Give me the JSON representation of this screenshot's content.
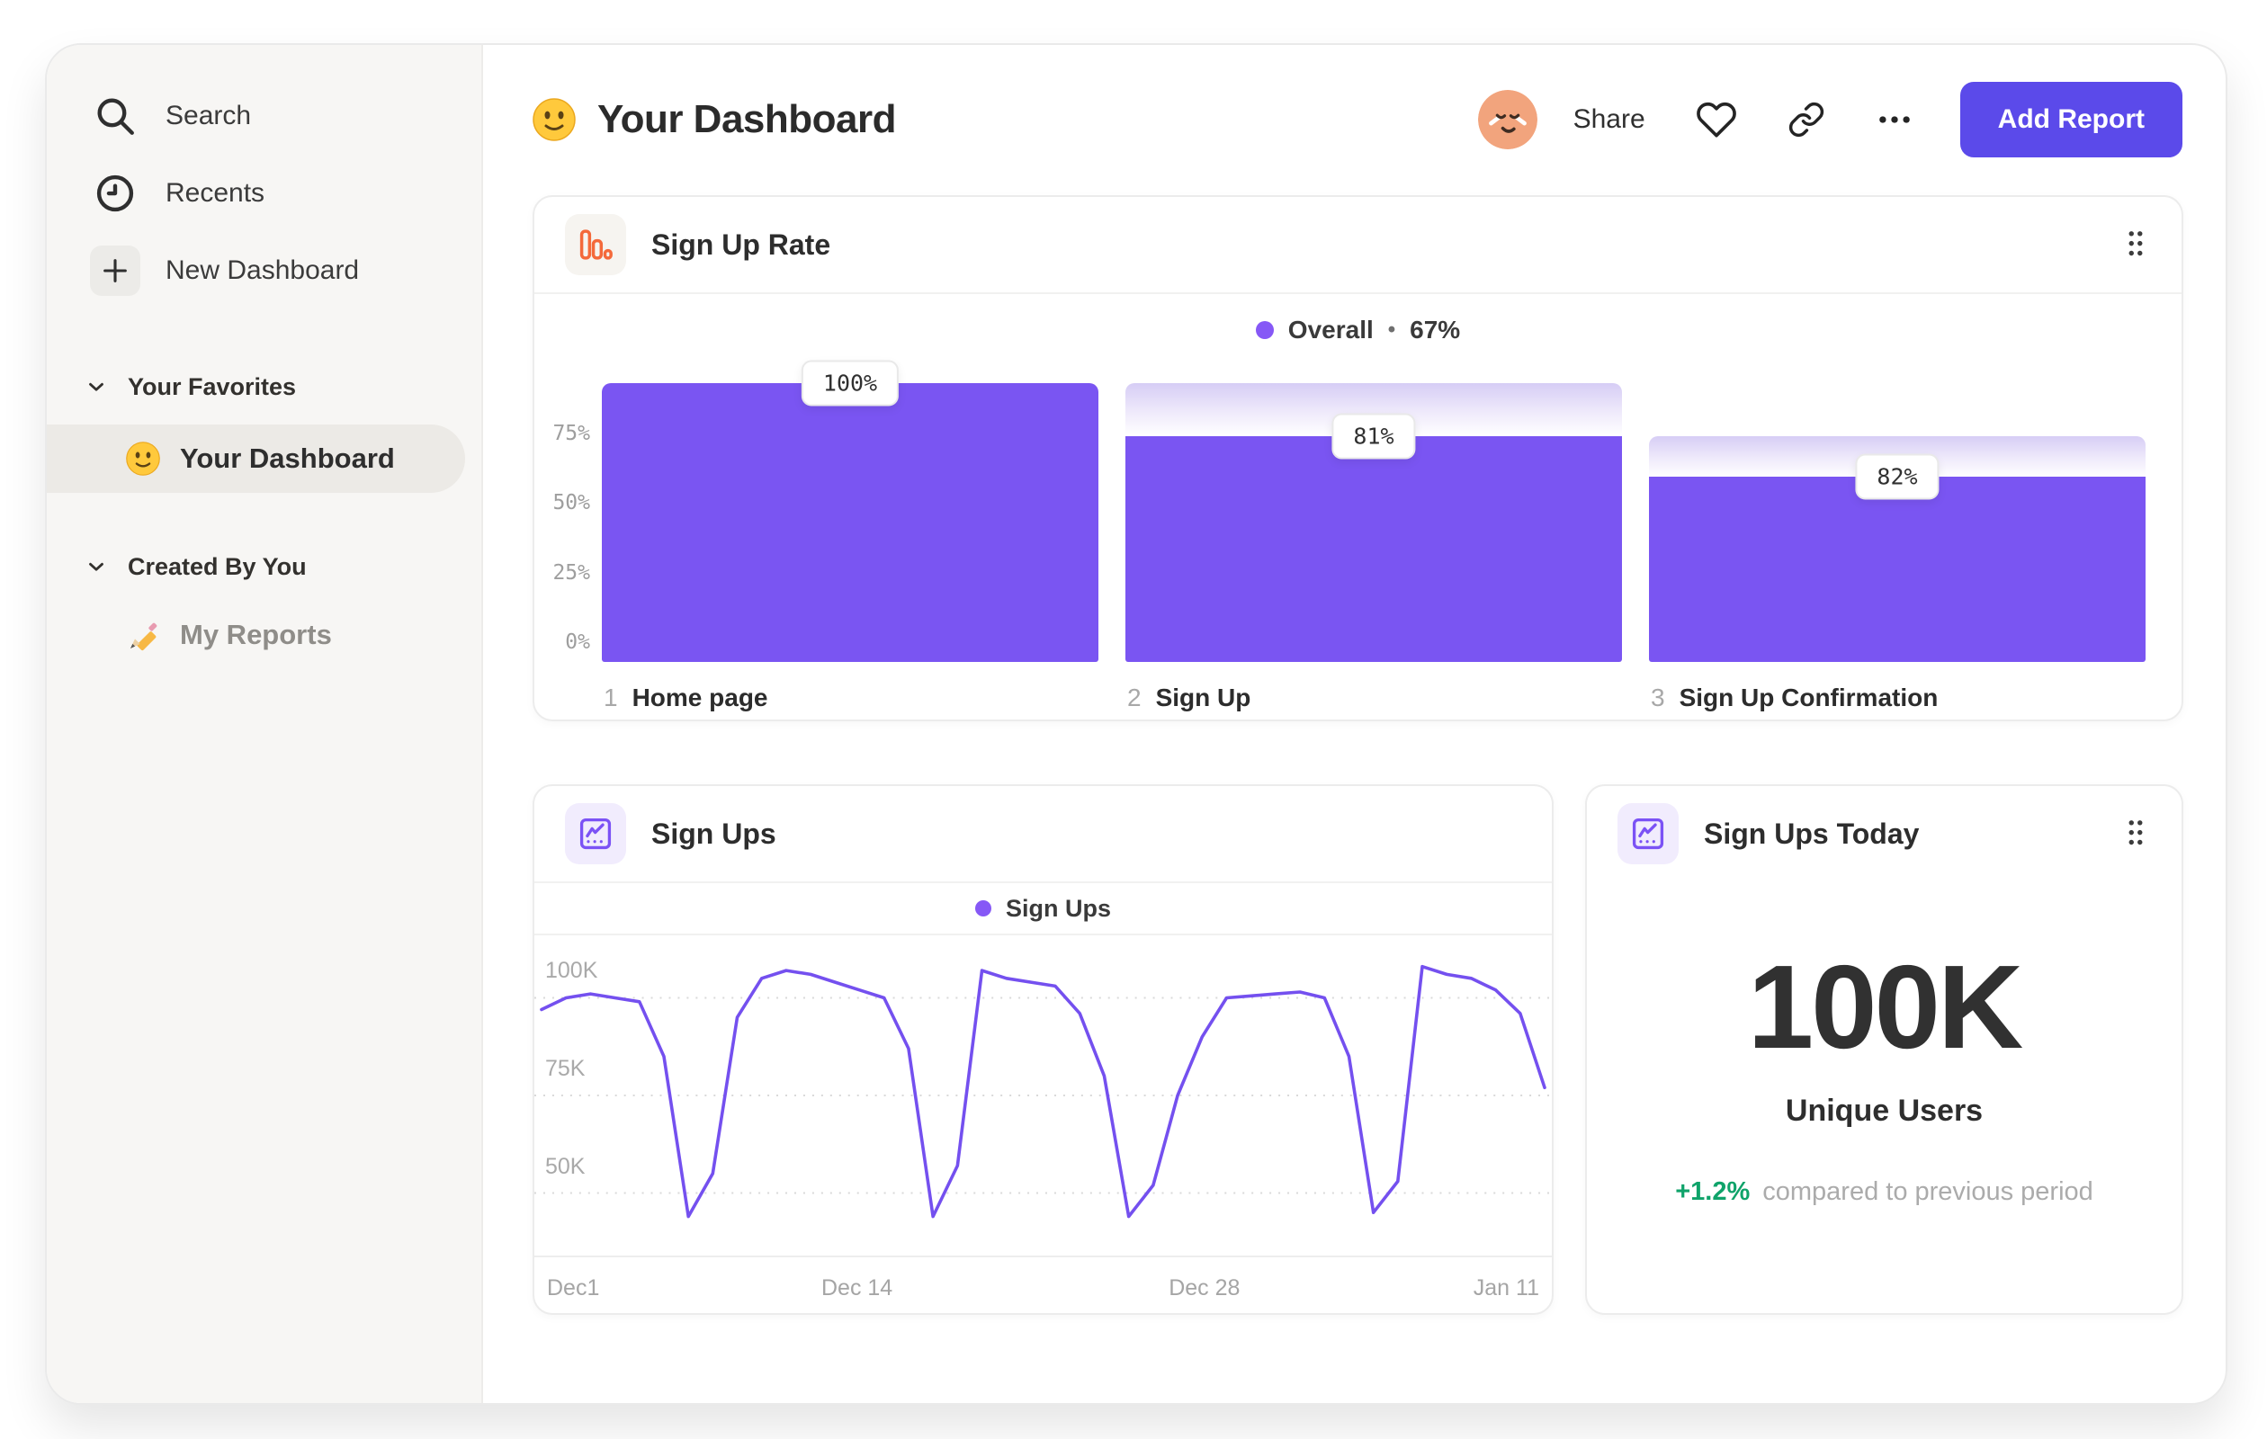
{
  "sidebar": {
    "items": [
      {
        "label": "Search",
        "icon": "search-icon"
      },
      {
        "label": "Recents",
        "icon": "clock-icon"
      },
      {
        "label": "New Dashboard",
        "icon": "plus-icon"
      }
    ],
    "sections": [
      {
        "label": "Your Favorites",
        "items": [
          {
            "label": "Your Dashboard",
            "icon": "smiley-emoji",
            "active": true
          }
        ]
      },
      {
        "label": "Created By You",
        "items": [
          {
            "label": "My Reports",
            "icon": "pencil-emoji",
            "active": false
          }
        ]
      }
    ]
  },
  "header": {
    "title": "Your Dashboard",
    "title_icon": "smiley-emoji",
    "share": "Share",
    "add_report": "Add Report"
  },
  "cards": {
    "sign_up_rate": {
      "title": "Sign Up Rate",
      "icon": "bar-chart-icon"
    },
    "sign_ups": {
      "title": "Sign Ups",
      "icon": "line-chart-icon"
    },
    "sign_ups_today": {
      "title": "Sign Ups Today",
      "icon": "line-chart-icon",
      "value": "100K",
      "value_label": "Unique Users",
      "delta": "+1.2%",
      "delta_caption": "compared to previous period"
    }
  },
  "chart_data": [
    {
      "id": "sign_up_rate_funnel",
      "type": "bar",
      "title": "Sign Up Rate",
      "legend": {
        "label": "Overall",
        "separator": "•",
        "value": "67%",
        "position": "top-center"
      },
      "categories": [
        "Home page",
        "Sign Up",
        "Sign Up Confirmation"
      ],
      "step_numbers": [
        "1",
        "2",
        "3"
      ],
      "values": [
        100,
        81,
        82
      ],
      "value_labels": [
        "100%",
        "81%",
        "82%"
      ],
      "cumulative_pct": [
        100,
        81,
        66.4
      ],
      "ghost_pct": [
        100,
        100,
        81
      ],
      "ylim": [
        0,
        100
      ],
      "yticks": [
        {
          "label": "75%",
          "value": 75
        },
        {
          "label": "50%",
          "value": 50
        },
        {
          "label": "25%",
          "value": 25
        },
        {
          "label": "0%",
          "value": 0
        }
      ],
      "grid": false,
      "bar_color": "#7a55f2"
    },
    {
      "id": "sign_ups_line",
      "type": "line",
      "title": "Sign Ups",
      "legend": {
        "label": "Sign Ups",
        "position": "top-center"
      },
      "unit": "K",
      "series": [
        {
          "name": "Sign Ups",
          "values": [
            97,
            100,
            101,
            100,
            99,
            85,
            44,
            55,
            95,
            105,
            107,
            106,
            104,
            102,
            100,
            87,
            44,
            57,
            107,
            105,
            104,
            103,
            96,
            80,
            44,
            52,
            75,
            90,
            100,
            100.5,
            101,
            101.5,
            100,
            85,
            45,
            53,
            108,
            106,
            105,
            102,
            96,
            77
          ]
        }
      ],
      "x_ticks": [
        {
          "label": "Dec1",
          "index": 0
        },
        {
          "label": "Dec 14",
          "index": 13
        },
        {
          "label": "Dec 28",
          "index": 27
        },
        {
          "label": "Jan 11",
          "index": 41
        }
      ],
      "yticks": [
        {
          "label": "100K",
          "value": 100
        },
        {
          "label": "75K",
          "value": 75
        },
        {
          "label": "50K",
          "value": 50
        }
      ],
      "ylim": [
        34,
        116
      ],
      "grid": "dashed-horizontal",
      "line_color": "#7450ef"
    }
  ],
  "colors": {
    "accent_purple": "#7a55f2",
    "ghost_lavender": "#d6cdf5",
    "button_indigo": "#5b4aea",
    "icon_orange": "#f4693b",
    "positive_green": "#0fa36a"
  }
}
